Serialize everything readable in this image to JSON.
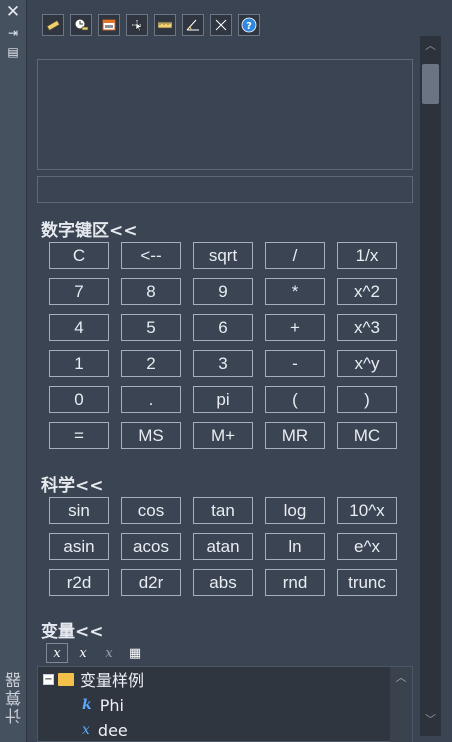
{
  "strip": {
    "close_icon": "✕",
    "pin_icon": "⇥",
    "props_icon": "▤",
    "title": "计算器"
  },
  "toolbar": {
    "buttons": [
      "clear-icon",
      "clear-history-icon",
      "paste-to-commandline-icon",
      "get-coordinates-icon",
      "distance-icon",
      "angle-icon",
      "intersection-icon",
      "help-icon"
    ]
  },
  "keypad": {
    "title": "数字键区<<",
    "rows": [
      [
        "C",
        "<--",
        "sqrt",
        "/",
        "1/x"
      ],
      [
        "7",
        "8",
        "9",
        "*",
        "x^2"
      ],
      [
        "4",
        "5",
        "6",
        "+",
        "x^3"
      ],
      [
        "1",
        "2",
        "3",
        "-",
        "x^y"
      ],
      [
        "0",
        ".",
        "pi",
        "(",
        ")"
      ],
      [
        "=",
        "MS",
        "M+",
        "MR",
        "MC"
      ]
    ]
  },
  "scientific": {
    "title": "科学<<",
    "rows": [
      [
        "sin",
        "cos",
        "tan",
        "log",
        "10^x"
      ],
      [
        "asin",
        "acos",
        "atan",
        "ln",
        "e^x"
      ],
      [
        "r2d",
        "d2r",
        "abs",
        "rnd",
        "trunc"
      ]
    ]
  },
  "variables": {
    "title": "变量<<",
    "tools": [
      "x",
      "x",
      "x",
      "▦"
    ],
    "tree": {
      "expander": "−",
      "folder_label": "变量样例",
      "items": [
        {
          "kind": "k",
          "name": "Phi"
        },
        {
          "kind": "x",
          "name": "dee"
        }
      ]
    }
  }
}
